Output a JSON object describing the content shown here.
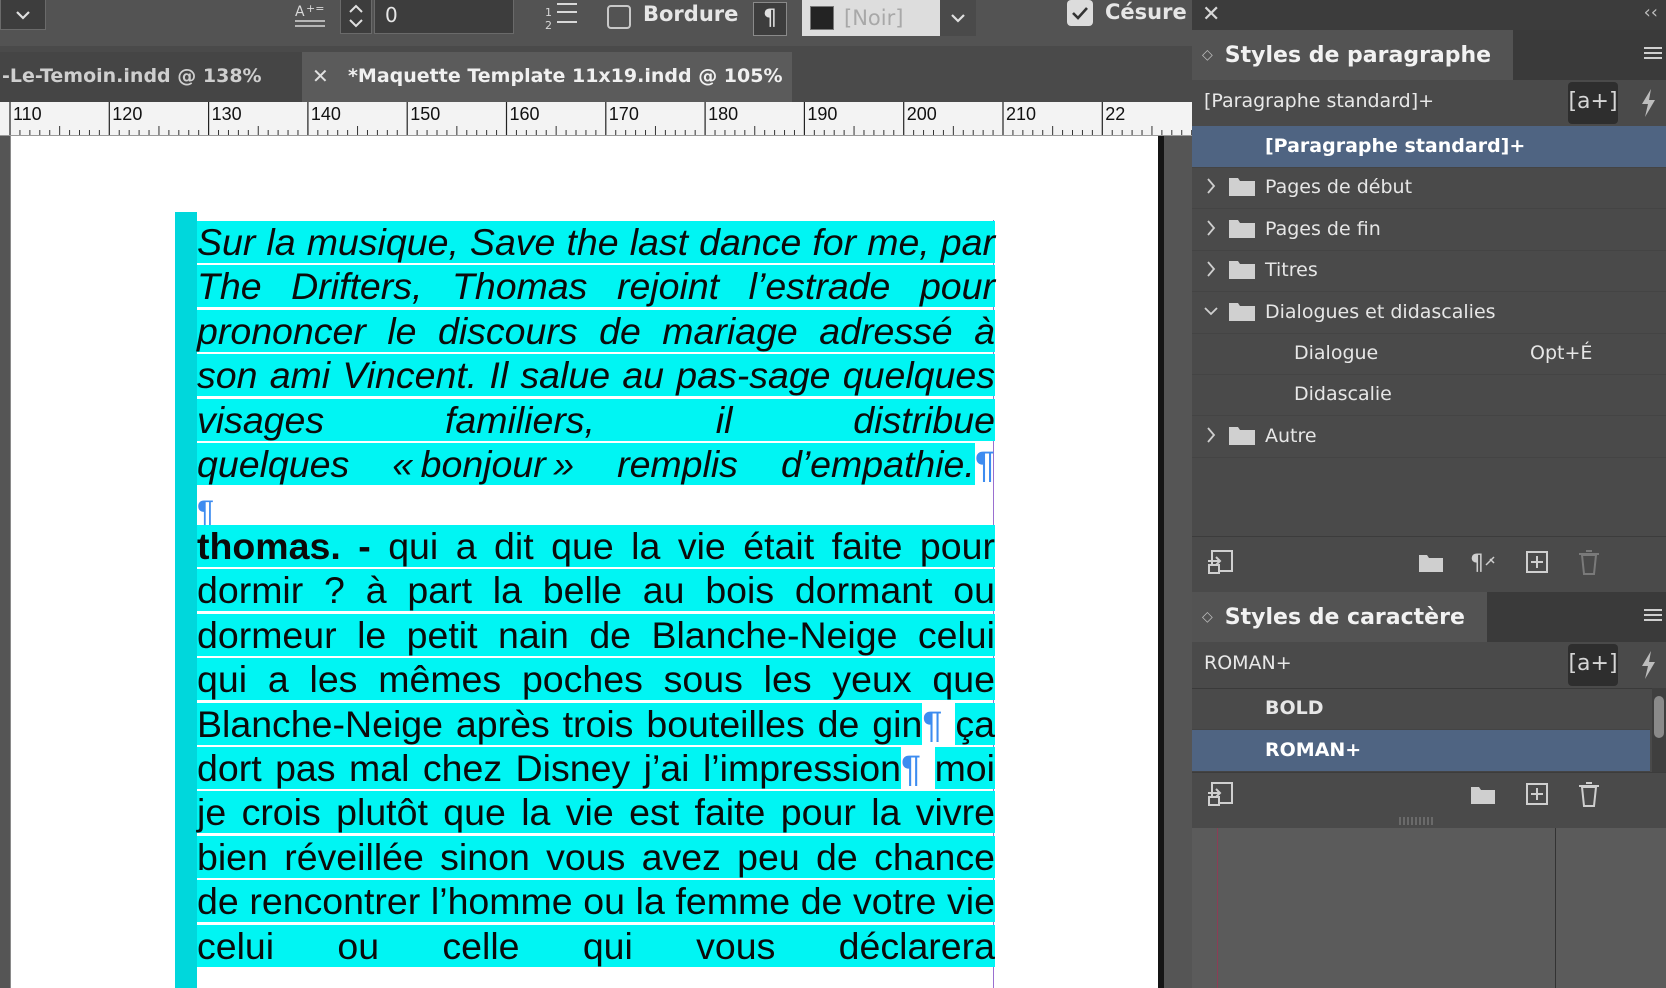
{
  "control_bar": {
    "value_field": "0",
    "border_label": "Bordure",
    "border_checked": false,
    "paragraph_button": "¶",
    "color_name": "[Noir]",
    "color_swatch": "#232323",
    "hyphenation_label": "Césure",
    "hyphenation_checked": true
  },
  "tabs": [
    {
      "label": "-Le-Temoin.indd @ 138%",
      "active": false
    },
    {
      "label": "*Maquette Template 11x19.indd @ 105%",
      "active": true,
      "close": "✕"
    }
  ],
  "ruler": {
    "labels": [
      "110",
      "120",
      "130",
      "140",
      "150",
      "160",
      "170",
      "180",
      "190",
      "200",
      "210",
      "22"
    ]
  },
  "document": {
    "highlight_color": "#00f5f3",
    "paragraph_1": "Sur la musique, Save the last dance for me, par The Drifters, Thomas rejoint l’estrade pour prononcer le discours de mariage adressé à son ami Vincent. Il salue au pas-sage quelques visages familiers, il distribue",
    "paragraph_1_last": "quelques « bonjour » remplis d’empathie.",
    "pilcrow": "¶",
    "speaker": "thomas. -",
    "paragraph_2a": " qui a dit que la vie était faite pour dormir ? à part la belle au bois dormant ou dormeur le petit nain de Blanche-Neige celui qui a les mêmes poches sous les yeux que Blanche-Neige après trois bouteilles de gin",
    "paragraph_2b": "ça dort pas mal chez Disney j’ai l’impression",
    "paragraph_2c": "moi je crois plutôt que la vie est faite pour la vivre bien réveillée sinon vous avez peu de chance de rencontrer l’homme ou la femme de votre vie celui ou celle qui vous déclarera"
  },
  "right_panel": {
    "close": "✕",
    "collapse": "‹‹",
    "paragraph_styles": {
      "title": "Styles de paragraphe",
      "current": "[Paragraphe standard]+",
      "new_override": "[a+]",
      "items": [
        {
          "label": "[Paragraphe standard]+",
          "selected": true,
          "indent": 1,
          "type": "style"
        },
        {
          "label": "Pages de début",
          "type": "group",
          "expanded": false
        },
        {
          "label": "Pages de fin",
          "type": "group",
          "expanded": false
        },
        {
          "label": "Titres",
          "type": "group",
          "expanded": false
        },
        {
          "label": "Dialogues et didascalies",
          "type": "group",
          "expanded": true
        },
        {
          "label": "Dialogue",
          "shortcut": "Opt+É",
          "indent": 2,
          "type": "style"
        },
        {
          "label": "Didascalie",
          "indent": 2,
          "type": "style"
        },
        {
          "label": "Autre",
          "type": "group",
          "expanded": false
        }
      ]
    },
    "character_styles": {
      "title": "Styles de caractère",
      "current": "ROMAN+",
      "new_override": "[a+]",
      "items": [
        {
          "label": "BOLD",
          "selected": false
        },
        {
          "label": "ROMAN+",
          "selected": true
        }
      ]
    }
  }
}
